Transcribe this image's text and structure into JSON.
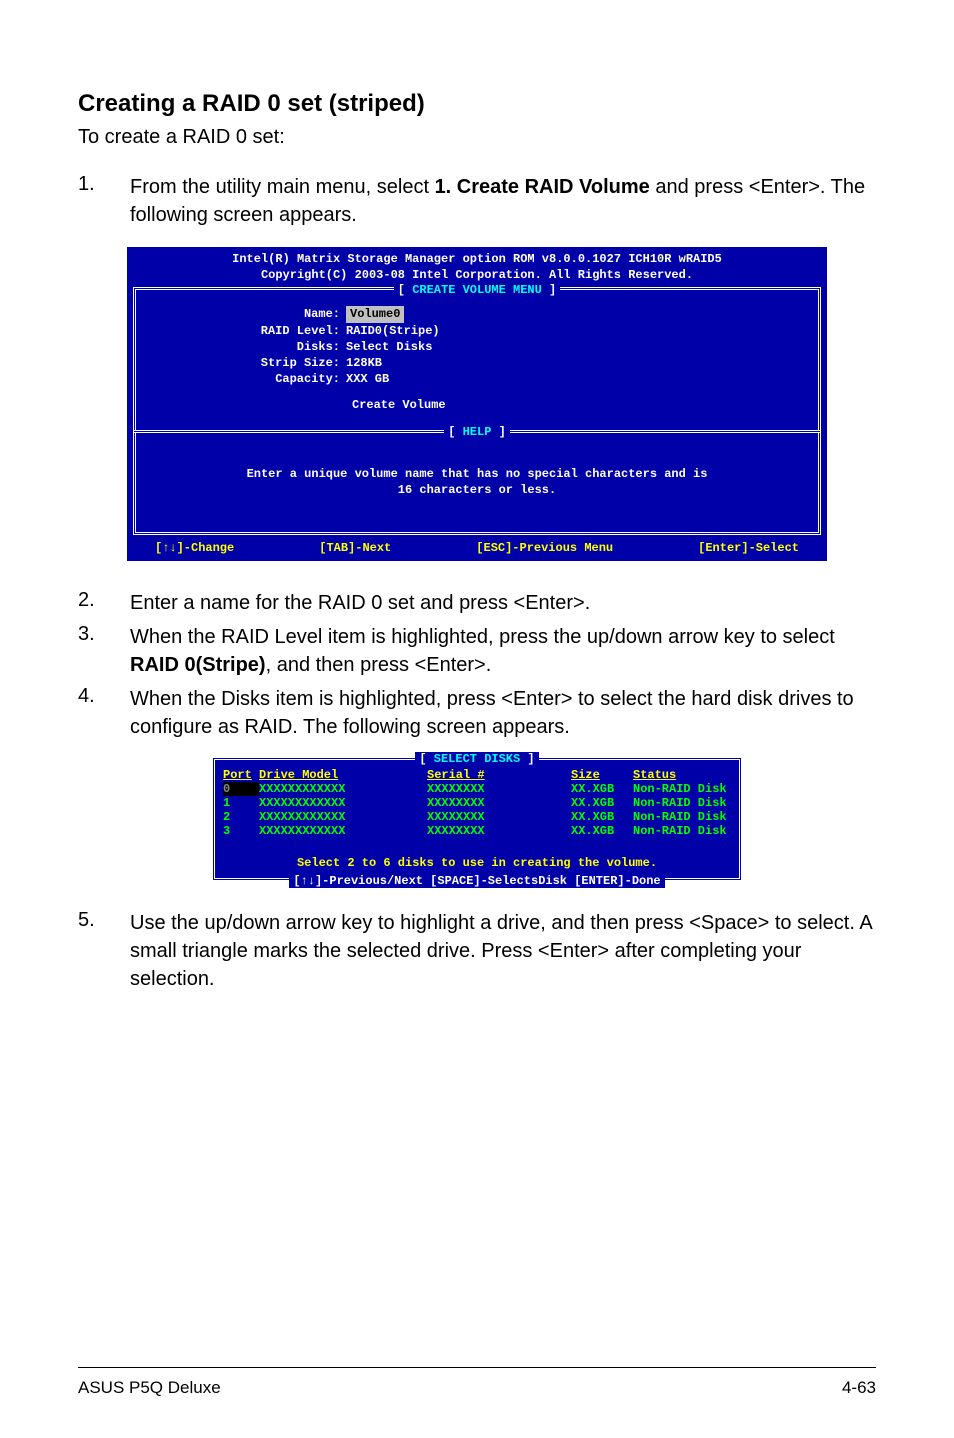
{
  "heading": "Creating a RAID 0 set (striped)",
  "intro": "To create a RAID 0 set:",
  "steps": {
    "s1": {
      "num": "1.",
      "pre": "From the utility main menu, select ",
      "bold": "1. Create RAID Volume",
      "post": " and press <Enter>. The following screen appears."
    },
    "s2": {
      "num": "2.",
      "text": "Enter a name for the RAID 0 set and press <Enter>."
    },
    "s3": {
      "num": "3.",
      "pre": "When the RAID Level item is highlighted, press the up/down arrow key to select ",
      "bold": "RAID 0(Stripe)",
      "post": ", and then press <Enter>."
    },
    "s4": {
      "num": "4.",
      "text": "When the Disks item is highlighted, press <Enter> to select the hard disk drives to configure as RAID. The following screen appears."
    },
    "s5": {
      "num": "5.",
      "text": "Use the up/down arrow key to highlight a drive, and then press <Space> to select. A small triangle marks the selected drive. Press <Enter> after completing your selection."
    }
  },
  "bios1": {
    "title1": "Intel(R) Matrix Storage Manager option ROM v8.0.0.1027 ICH10R wRAID5",
    "title2": "Copyright(C) 2003-08 Intel Corporation. All Rights Reserved.",
    "menu_label": "CREATE VOLUME MENU",
    "name_label": "Name:",
    "name_value": "Volume0",
    "raid_label": "RAID Level:",
    "raid_value": "RAID0(Stripe)",
    "disks_label": "Disks:",
    "disks_value": "Select Disks",
    "strip_label": "Strip Size:",
    "strip_value": "128KB",
    "cap_label": "Capacity:",
    "cap_value": "XXX   GB",
    "create_volume": "Create Volume",
    "help_label": "HELP",
    "help1": "Enter a unique volume name that has no special characters and is",
    "help2": "16 characters or less.",
    "k1": "[↑↓]-Change",
    "k2": "[TAB]-Next",
    "k3": "[ESC]-Previous Menu",
    "k4": "[Enter]-Select"
  },
  "bios2": {
    "title": "SELECT DISKS",
    "h_port": "Port",
    "h_model": "Drive Model",
    "h_serial": "Serial #",
    "h_size": "Size",
    "h_status": "Status",
    "rows": [
      {
        "port": "0",
        "model": "XXXXXXXXXXXX",
        "serial": "XXXXXXXX",
        "size": "XX.XGB",
        "status": "Non-RAID Disk"
      },
      {
        "port": "1",
        "model": "XXXXXXXXXXXX",
        "serial": "XXXXXXXX",
        "size": "XX.XGB",
        "status": "Non-RAID Disk"
      },
      {
        "port": "2",
        "model": "XXXXXXXXXXXX",
        "serial": "XXXXXXXX",
        "size": "XX.XGB",
        "status": "Non-RAID Disk"
      },
      {
        "port": "3",
        "model": "XXXXXXXXXXXX",
        "serial": "XXXXXXXX",
        "size": "XX.XGB",
        "status": "Non-RAID Disk"
      }
    ],
    "msg": "Select 2 to 6 disks to use in creating the volume.",
    "keys": "[↑↓]-Previous/Next  [SPACE]-SelectsDisk  [ENTER]-Done"
  },
  "footer": {
    "left": "ASUS P5Q Deluxe",
    "right": "4-63"
  }
}
